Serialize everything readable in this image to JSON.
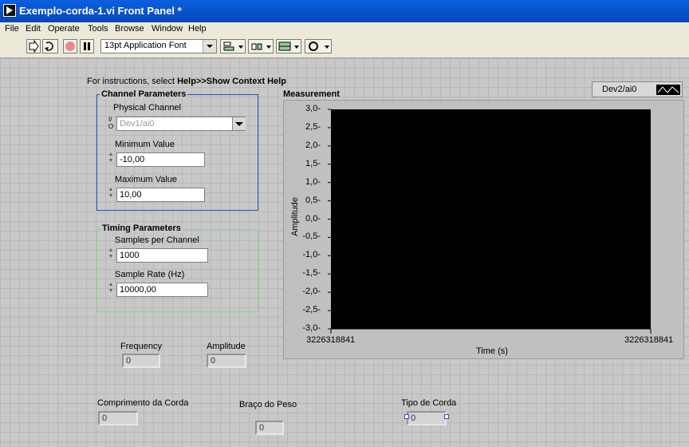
{
  "window": {
    "title": "Exemplo-corda-1.vi Front Panel *"
  },
  "menu": [
    "File",
    "Edit",
    "Operate",
    "Tools",
    "Browse",
    "Window",
    "Help"
  ],
  "toolbar": {
    "font": "13pt Application Font"
  },
  "instructions": {
    "prefix": "For instructions, select ",
    "emph": "Help>>Show Context Help"
  },
  "channel": {
    "group_title": "Channel Parameters",
    "physical_label": "Physical Channel",
    "physical_value": "Dev1/ai0",
    "io_glyph": "I/O",
    "min_label": "Minimum Value",
    "min_value": "-10,00",
    "max_label": "Maximum Value",
    "max_value": "10,00"
  },
  "timing": {
    "group_title": "Timing Parameters",
    "samples_label": "Samples per Channel",
    "samples_value": "1000",
    "rate_label": "Sample Rate (Hz)",
    "rate_value": "10000,00"
  },
  "graph": {
    "title": "Measurement",
    "legend": "Dev2/ai0",
    "ylabel": "Amplitude",
    "xlabel": "Time (s)",
    "x_start": "3226318841",
    "x_end": "3226318841",
    "y_ticks": [
      "3,0",
      "2,5",
      "2,0",
      "1,5",
      "1,0",
      "0,5",
      "0,0",
      "-0,5",
      "-1,0",
      "-1,5",
      "-2,0",
      "-2,5",
      "-3,0"
    ]
  },
  "indicators": {
    "frequency_label": "Frequency",
    "frequency_value": "0",
    "amplitude_label": "Amplitude",
    "amplitude_value": "0",
    "comprimento_label": "Comprimento da Corda",
    "comprimento_value": "0",
    "braco_label": "Braço do Peso",
    "braco_value": "0",
    "tipo_label": "Tipo de Corda",
    "tipo_value": "0"
  },
  "colors": {
    "titlebar": "#0747b8",
    "channel_border": "#2a52be",
    "timing_border": "#8fd08f",
    "plot_bg": "#000000"
  }
}
